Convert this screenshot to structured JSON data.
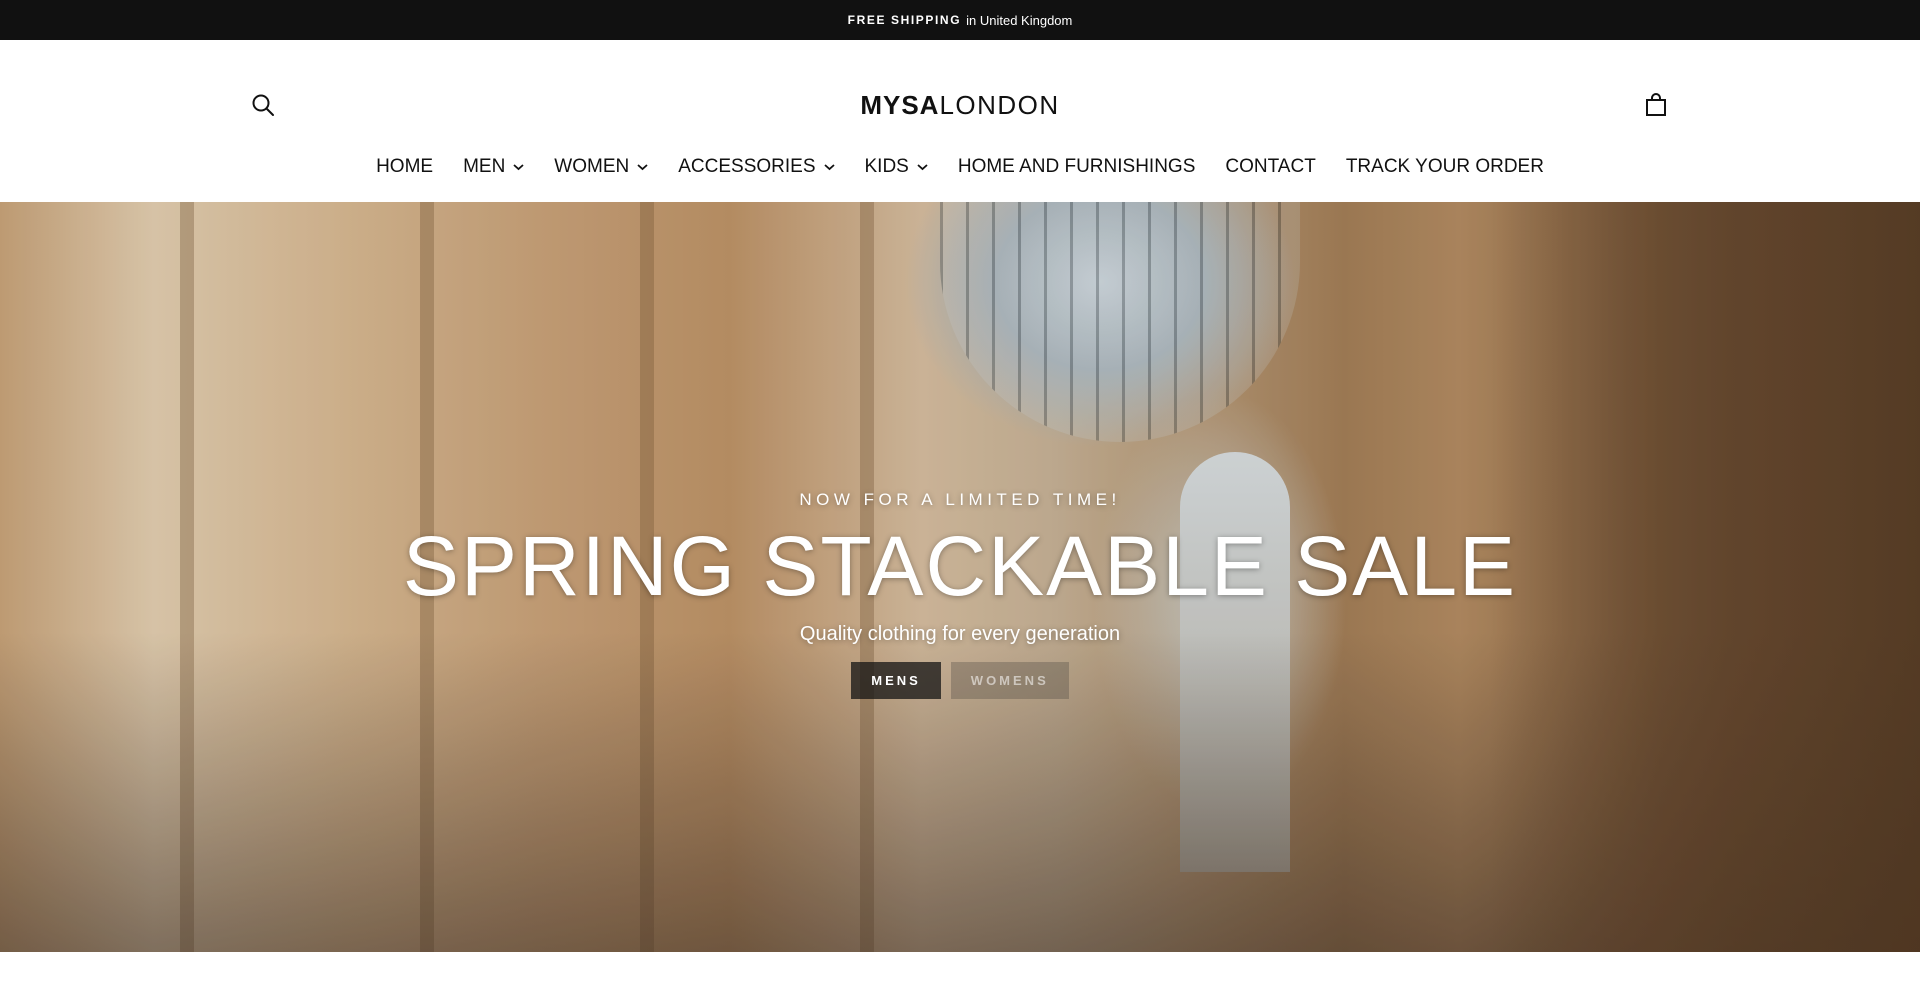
{
  "announcement": {
    "strong": "FREE SHIPPING",
    "rest": "in United Kingdom"
  },
  "header": {
    "logo_bold": "MYSA",
    "logo_light": "LONDON",
    "search_icon": "search-icon",
    "cart_icon": "shopping-bag-icon"
  },
  "nav": {
    "items": [
      {
        "label": "HOME",
        "dropdown": false
      },
      {
        "label": "MEN",
        "dropdown": true
      },
      {
        "label": "WOMEN",
        "dropdown": true
      },
      {
        "label": "ACCESSORIES",
        "dropdown": true
      },
      {
        "label": "KIDS",
        "dropdown": true
      },
      {
        "label": "HOME AND FURNISHINGS",
        "dropdown": false
      },
      {
        "label": "CONTACT",
        "dropdown": false
      },
      {
        "label": "TRACK YOUR ORDER",
        "dropdown": false
      }
    ]
  },
  "hero": {
    "eyebrow": "NOW FOR A LIMITED TIME!",
    "title": "SPRING STACKABLE SALE",
    "subtitle": "Quality clothing for every generation",
    "buttons": {
      "mens": "MENS",
      "womens": "WOMENS"
    }
  },
  "colors": {
    "announcement_bg": "#111111",
    "text": "#111111",
    "hero_text": "#ffffff"
  }
}
